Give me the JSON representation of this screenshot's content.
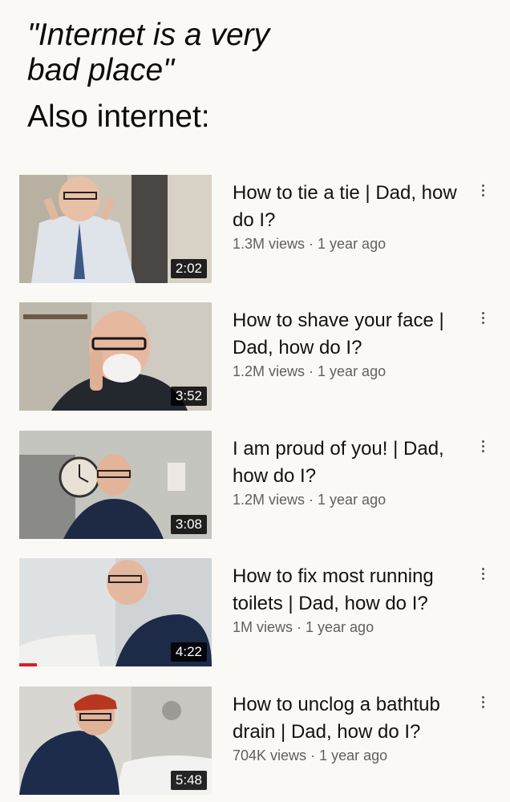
{
  "header": {
    "quote_line1": "\"Internet is a very",
    "quote_line2": "bad place\"",
    "also_line": "Also internet:"
  },
  "videos": [
    {
      "title": "How to tie a tie | Dad, how do I?",
      "views": "1.3M views",
      "age": "1 year ago",
      "duration": "2:02",
      "watch_progress": 0
    },
    {
      "title": "How to shave your face | Dad, how do I?",
      "views": "1.2M views",
      "age": "1 year ago",
      "duration": "3:52",
      "watch_progress": 0
    },
    {
      "title": "I am proud of you! | Dad, how do I?",
      "views": "1.2M views",
      "age": "1 year ago",
      "duration": "3:08",
      "watch_progress": 0
    },
    {
      "title": "How to fix most running toilets | Dad, how do I?",
      "views": "1M views",
      "age": "1 year ago",
      "duration": "4:22",
      "watch_progress": 0.09
    },
    {
      "title": "How to unclog a bathtub drain | Dad, how do I?",
      "views": "704K views",
      "age": "1 year ago",
      "duration": "5:48",
      "watch_progress": 0
    }
  ],
  "meta_separator": " · ",
  "icons": {
    "more": "more-vert-icon"
  },
  "colors": {
    "progress": "#d3202a",
    "meta_text": "#606060"
  }
}
